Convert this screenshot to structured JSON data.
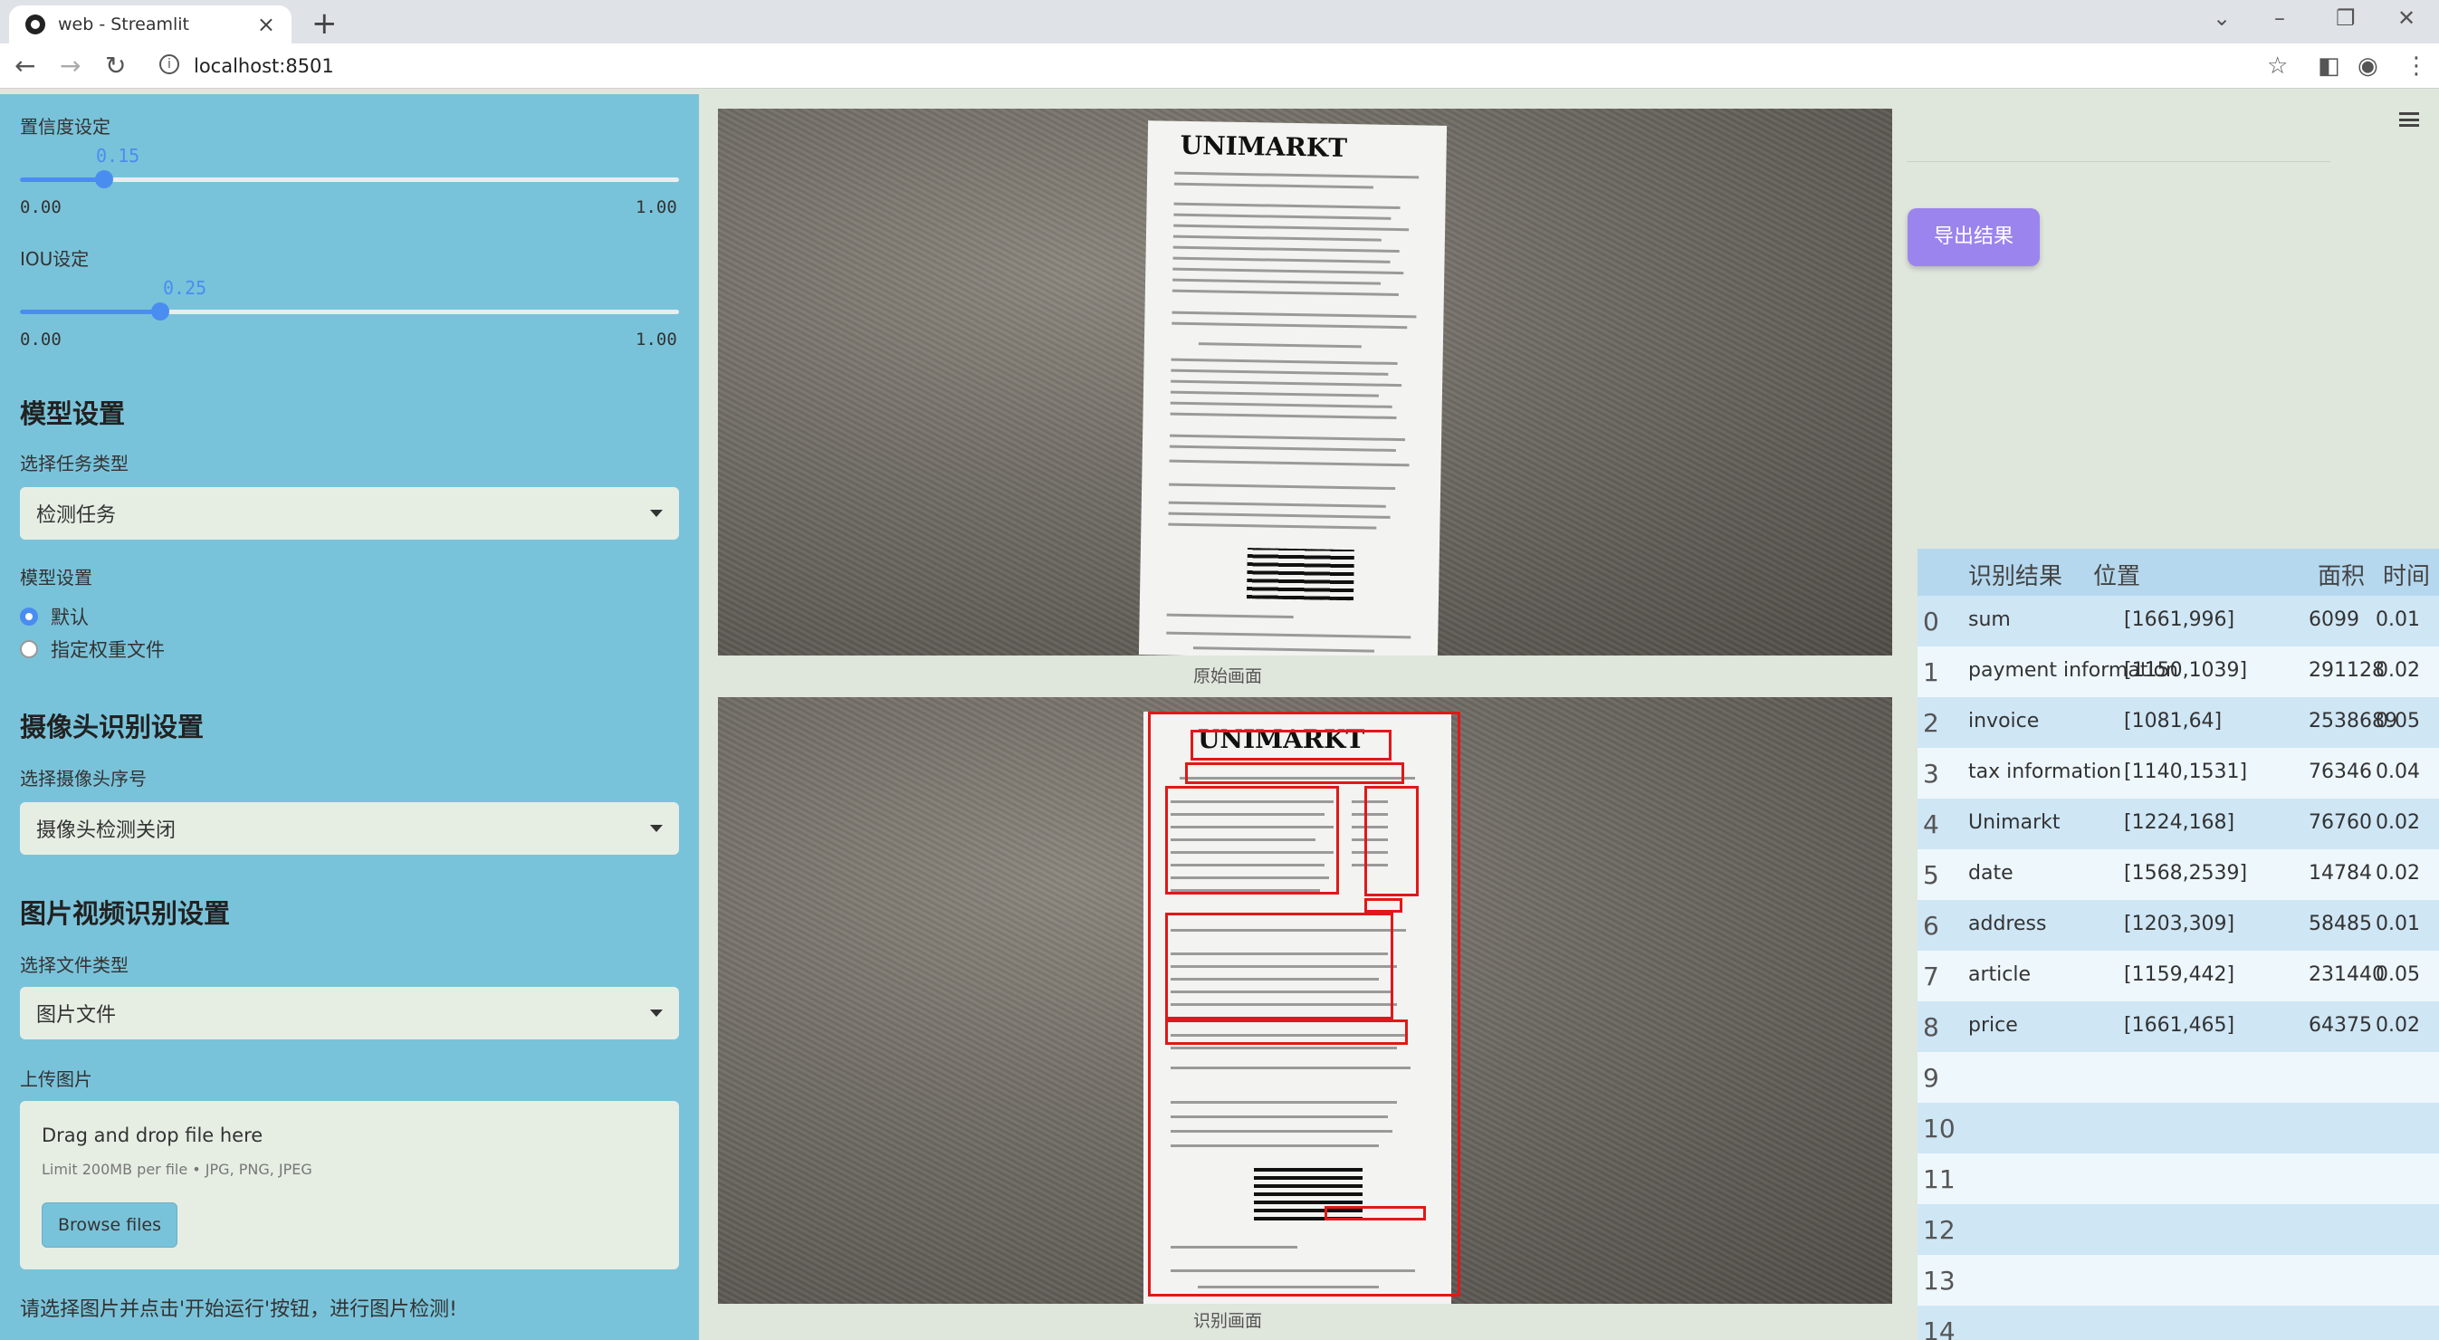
{
  "browser": {
    "tab_title": "web - Streamlit",
    "url": "localhost:8501"
  },
  "sidebar": {
    "confidence": {
      "label": "置信度设定",
      "value": "0.15",
      "min": "0.00",
      "max": "1.00",
      "fraction": 0.15
    },
    "iou": {
      "label": "IOU设定",
      "value": "0.25",
      "min": "0.00",
      "max": "1.00",
      "fraction": 0.25
    },
    "model_heading": "模型设置",
    "task_label": "选择任务类型",
    "task_value": "检测任务",
    "model_label": "模型设置",
    "model_options": [
      "默认",
      "指定权重文件"
    ],
    "model_selected": 0,
    "camera_heading": "摄像头识别设置",
    "camera_label": "选择摄像头序号",
    "camera_value": "摄像头检测关闭",
    "media_heading": "图片视频识别设置",
    "filetype_label": "选择文件类型",
    "filetype_value": "图片文件",
    "upload_label": "上传图片",
    "upload_title": "Drag and drop file here",
    "upload_sub": "Limit 200MB per file • JPG, PNG, JPEG",
    "browse_label": "Browse files",
    "hint": "请选择图片并点击'开始运行'按钮，进行图片检测!"
  },
  "main": {
    "receipt_brand": "UNIMARKT",
    "caption_original": "原始画面",
    "caption_result": "识别画面"
  },
  "results": {
    "export_label": "导出结果",
    "columns": [
      "识别结果",
      "位置",
      "面积",
      "时间"
    ],
    "rows": [
      {
        "idx": "0",
        "label": "sum",
        "pos": "[1661,996]",
        "area": "6099",
        "time": "0.01"
      },
      {
        "idx": "1",
        "label": "payment information",
        "pos": "[1150,1039]",
        "area": "291128",
        "time": "0.02"
      },
      {
        "idx": "2",
        "label": "invoice",
        "pos": "[1081,64]",
        "area": "2538689",
        "time": "0.05"
      },
      {
        "idx": "3",
        "label": "tax information",
        "pos": "[1140,1531]",
        "area": "76346",
        "time": "0.04"
      },
      {
        "idx": "4",
        "label": "Unimarkt",
        "pos": "[1224,168]",
        "area": "76760",
        "time": "0.02"
      },
      {
        "idx": "5",
        "label": "date",
        "pos": "[1568,2539]",
        "area": "14784",
        "time": "0.02"
      },
      {
        "idx": "6",
        "label": "address",
        "pos": "[1203,309]",
        "area": "58485",
        "time": "0.01"
      },
      {
        "idx": "7",
        "label": "article",
        "pos": "[1159,442]",
        "area": "231440",
        "time": "0.05"
      },
      {
        "idx": "8",
        "label": "price",
        "pos": "[1661,465]",
        "area": "64375",
        "time": "0.02"
      },
      {
        "idx": "9",
        "label": "",
        "pos": "",
        "area": "",
        "time": ""
      },
      {
        "idx": "10",
        "label": "",
        "pos": "",
        "area": "",
        "time": ""
      },
      {
        "idx": "11",
        "label": "",
        "pos": "",
        "area": "",
        "time": ""
      },
      {
        "idx": "12",
        "label": "",
        "pos": "",
        "area": "",
        "time": ""
      },
      {
        "idx": "13",
        "label": "",
        "pos": "",
        "area": "",
        "time": ""
      },
      {
        "idx": "14",
        "label": "",
        "pos": "",
        "area": "",
        "time": ""
      }
    ]
  },
  "colors": {
    "sidebar_bg": "#79c3da",
    "accent": "#4a8df0",
    "export_button": "#9c84ee",
    "detection_box": "#e01818"
  }
}
